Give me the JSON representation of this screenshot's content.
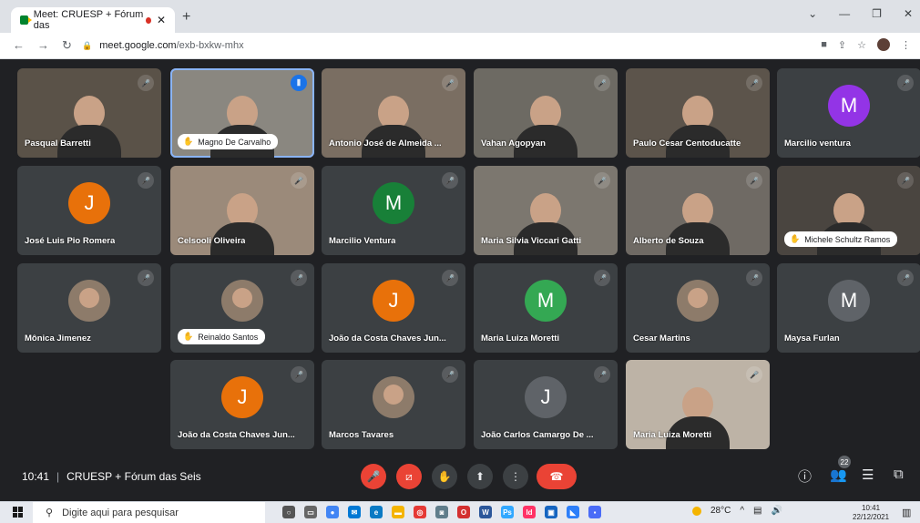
{
  "browser": {
    "tab_title": "Meet: CRUESP + Fórum das",
    "url_host": "meet.google.com",
    "url_path": "/exb-bxkw-mhx"
  },
  "tiles": [
    {
      "id": "t1",
      "name": "Pasqual Barretti",
      "style": "name",
      "video": true
    },
    {
      "id": "t2",
      "name": "Magno De Carvalho",
      "style": "pill",
      "video": true
    },
    {
      "id": "t3",
      "name": "Antonio José de Almeida ...",
      "style": "name",
      "video": true
    },
    {
      "id": "t4",
      "name": "Vahan Agopyan",
      "style": "name",
      "video": true
    },
    {
      "id": "t5",
      "name": "Paulo Cesar Centoducatte",
      "style": "name",
      "video": true
    },
    {
      "id": "t6",
      "name": "Marcilio ventura",
      "style": "name",
      "avatar_letter": "M",
      "avatar_color": "#9334e6"
    },
    {
      "id": "t7",
      "name": "José Luis Pio Romera",
      "style": "name",
      "avatar_letter": "J",
      "avatar_color": "#e8710a"
    },
    {
      "id": "t8",
      "name": "Celsooli Oliveira",
      "style": "name",
      "video": true
    },
    {
      "id": "t9",
      "name": "Marcilio Ventura",
      "style": "name",
      "avatar_letter": "M",
      "avatar_color": "#188038"
    },
    {
      "id": "t10",
      "name": "Maria Silvia Viccari Gatti",
      "style": "name",
      "video": true
    },
    {
      "id": "t11",
      "name": "Alberto de Souza",
      "style": "name",
      "video": true
    },
    {
      "id": "t12",
      "name": "Michele Schultz Ramos",
      "style": "pill",
      "video": true
    },
    {
      "id": "t13",
      "name": "Mônica Jimenez",
      "style": "name",
      "avatar_photo": true
    },
    {
      "id": "t14",
      "name": "Reinaldo Santos",
      "style": "pill",
      "avatar_photo": true
    },
    {
      "id": "t15",
      "name": "João da Costa Chaves Jun...",
      "style": "name",
      "avatar_letter": "J",
      "avatar_color": "#e8710a"
    },
    {
      "id": "t16",
      "name": "Maria Luiza Moretti",
      "style": "name",
      "avatar_letter": "M",
      "avatar_color": "#34a853"
    },
    {
      "id": "t17",
      "name": "Cesar Martins",
      "style": "name",
      "avatar_photo": true
    },
    {
      "id": "t18",
      "name": "Maysa Furlan",
      "style": "name",
      "avatar_letter": "M",
      "avatar_color": "#5f6368"
    },
    {
      "id": "t19",
      "name": "João da Costa Chaves Jun...",
      "style": "name",
      "avatar_letter": "J",
      "avatar_color": "#e8710a"
    },
    {
      "id": "t20",
      "name": "Marcos Tavares",
      "style": "name",
      "avatar_photo": true
    },
    {
      "id": "t21",
      "name": "João Carlos Camargo De ...",
      "style": "name",
      "avatar_letter": "J",
      "avatar_color": "#5f6368"
    },
    {
      "id": "t22",
      "name": "Maria Luiza Moretti",
      "style": "name",
      "video": true
    }
  ],
  "meeting": {
    "time": "10:41",
    "title": "CRUESP + Fórum das Seis",
    "participants_count": "22"
  },
  "taskbar": {
    "search_placeholder": "Digite aqui para pesquisar",
    "weather": "28°C",
    "time": "10:41",
    "date": "22/12/2021"
  }
}
